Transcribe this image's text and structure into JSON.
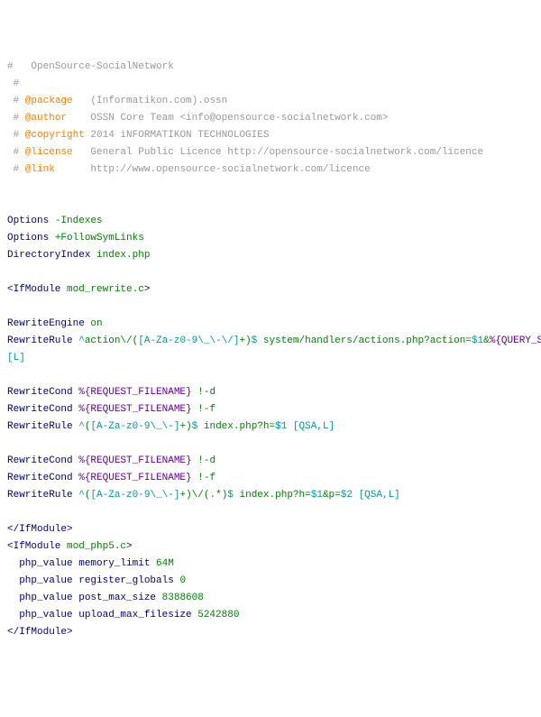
{
  "lines": [
    [
      {
        "text": "#   OpenSource-SocialNetwork",
        "cls": "c-gray"
      }
    ],
    [
      {
        "text": " #",
        "cls": "c-gray"
      }
    ],
    [
      {
        "text": " # ",
        "cls": "c-gray"
      },
      {
        "text": "@package",
        "cls": "c-orange"
      },
      {
        "text": "   (Informatikon.com).ossn",
        "cls": "c-gray"
      }
    ],
    [
      {
        "text": " # ",
        "cls": "c-gray"
      },
      {
        "text": "@author",
        "cls": "c-orange"
      },
      {
        "text": "    OSSN Core Team <info@opensource-socialnetwork.com>",
        "cls": "c-gray"
      }
    ],
    [
      {
        "text": " # ",
        "cls": "c-gray"
      },
      {
        "text": "@copyright",
        "cls": "c-orange"
      },
      {
        "text": " 2014 iNFORMATIKON TECHNOLOGIES",
        "cls": "c-gray"
      }
    ],
    [
      {
        "text": " # ",
        "cls": "c-gray"
      },
      {
        "text": "@license",
        "cls": "c-orange"
      },
      {
        "text": "   General Public Licence http://opensource-socialnetwork.com/licence ",
        "cls": "c-gray"
      }
    ],
    [
      {
        "text": " # ",
        "cls": "c-gray"
      },
      {
        "text": "@link",
        "cls": "c-orange"
      },
      {
        "text": "      http://www.opensource-socialnetwork.com/licence",
        "cls": "c-gray"
      }
    ],
    [],
    [],
    [
      {
        "text": "Options ",
        "cls": "c-navy"
      },
      {
        "text": "-Indexes",
        "cls": "c-green"
      }
    ],
    [
      {
        "text": "Options ",
        "cls": "c-navy"
      },
      {
        "text": "+FollowSymLinks",
        "cls": "c-green"
      }
    ],
    [
      {
        "text": "DirectoryIndex ",
        "cls": "c-navy"
      },
      {
        "text": "index.php",
        "cls": "c-green"
      }
    ],
    [],
    [
      {
        "text": "<IfModule ",
        "cls": "c-navy"
      },
      {
        "text": "mod_rewrite.c",
        "cls": "c-green"
      },
      {
        "text": ">",
        "cls": "c-navy"
      }
    ],
    [],
    [
      {
        "text": "RewriteEngine ",
        "cls": "c-navy"
      },
      {
        "text": "on",
        "cls": "c-green"
      }
    ],
    [
      {
        "text": "RewriteRule ",
        "cls": "c-navy"
      },
      {
        "text": "^",
        "cls": "c-teal"
      },
      {
        "text": "action\\/(",
        "cls": "c-green"
      },
      {
        "text": "[A-Za-z0-9\\_\\-\\/]",
        "cls": "c-teal"
      },
      {
        "text": "+)",
        "cls": "c-green"
      },
      {
        "text": "$",
        "cls": "c-teal"
      },
      {
        "text": " system/handlers/actions.php?action=",
        "cls": "c-green"
      },
      {
        "text": "$1",
        "cls": "c-teal"
      },
      {
        "text": "&",
        "cls": "c-green"
      },
      {
        "text": "%{QUERY_STRING}",
        "cls": "c-purple"
      },
      {
        "text": " ",
        "cls": "c-green"
      }
    ],
    [
      {
        "text": "[L]",
        "cls": "c-teal"
      }
    ],
    [],
    [
      {
        "text": "RewriteCond ",
        "cls": "c-navy"
      },
      {
        "text": "%{REQUEST_FILENAME}",
        "cls": "c-purple"
      },
      {
        "text": " !-d",
        "cls": "c-green"
      }
    ],
    [
      {
        "text": "RewriteCond ",
        "cls": "c-navy"
      },
      {
        "text": "%{REQUEST_FILENAME}",
        "cls": "c-purple"
      },
      {
        "text": " !-f",
        "cls": "c-green"
      }
    ],
    [
      {
        "text": "RewriteRule ",
        "cls": "c-navy"
      },
      {
        "text": "^",
        "cls": "c-teal"
      },
      {
        "text": "(",
        "cls": "c-green"
      },
      {
        "text": "[A-Za-z0-9\\_\\-]",
        "cls": "c-teal"
      },
      {
        "text": "+)",
        "cls": "c-green"
      },
      {
        "text": "$",
        "cls": "c-teal"
      },
      {
        "text": " index.php?h=",
        "cls": "c-green"
      },
      {
        "text": "$1",
        "cls": "c-teal"
      },
      {
        "text": " ",
        "cls": "c-green"
      },
      {
        "text": "[QSA,L]",
        "cls": "c-teal"
      }
    ],
    [],
    [
      {
        "text": "RewriteCond ",
        "cls": "c-navy"
      },
      {
        "text": "%{REQUEST_FILENAME}",
        "cls": "c-purple"
      },
      {
        "text": " !-d",
        "cls": "c-green"
      }
    ],
    [
      {
        "text": "RewriteCond ",
        "cls": "c-navy"
      },
      {
        "text": "%{REQUEST_FILENAME}",
        "cls": "c-purple"
      },
      {
        "text": " !-f",
        "cls": "c-green"
      }
    ],
    [
      {
        "text": "RewriteRule ",
        "cls": "c-navy"
      },
      {
        "text": "^",
        "cls": "c-teal"
      },
      {
        "text": "(",
        "cls": "c-green"
      },
      {
        "text": "[A-Za-z0-9\\_\\-]",
        "cls": "c-teal"
      },
      {
        "text": "+)\\/(",
        "cls": "c-green"
      },
      {
        "text": ".",
        "cls": "c-teal"
      },
      {
        "text": "*)",
        "cls": "c-green"
      },
      {
        "text": "$",
        "cls": "c-teal"
      },
      {
        "text": " index.php?h=",
        "cls": "c-green"
      },
      {
        "text": "$1",
        "cls": "c-teal"
      },
      {
        "text": "&p=",
        "cls": "c-green"
      },
      {
        "text": "$2",
        "cls": "c-teal"
      },
      {
        "text": " ",
        "cls": "c-green"
      },
      {
        "text": "[QSA,L]",
        "cls": "c-teal"
      }
    ],
    [],
    [
      {
        "text": "</IfModule>",
        "cls": "c-navy"
      }
    ],
    [
      {
        "text": "<IfModule ",
        "cls": "c-navy"
      },
      {
        "text": "mod_php5.c",
        "cls": "c-green"
      },
      {
        "text": ">",
        "cls": "c-navy"
      }
    ],
    [
      {
        "text": "  php_value memory_limit ",
        "cls": "c-navy"
      },
      {
        "text": "64M",
        "cls": "c-green"
      }
    ],
    [
      {
        "text": "  php_value register_globals ",
        "cls": "c-navy"
      },
      {
        "text": "0",
        "cls": "c-green"
      }
    ],
    [
      {
        "text": "  php_value post_max_size ",
        "cls": "c-navy"
      },
      {
        "text": "8388608",
        "cls": "c-green"
      }
    ],
    [
      {
        "text": "  php_value upload_max_filesize ",
        "cls": "c-navy"
      },
      {
        "text": "5242880",
        "cls": "c-green"
      }
    ],
    [
      {
        "text": "</IfModule>",
        "cls": "c-navy"
      }
    ]
  ]
}
